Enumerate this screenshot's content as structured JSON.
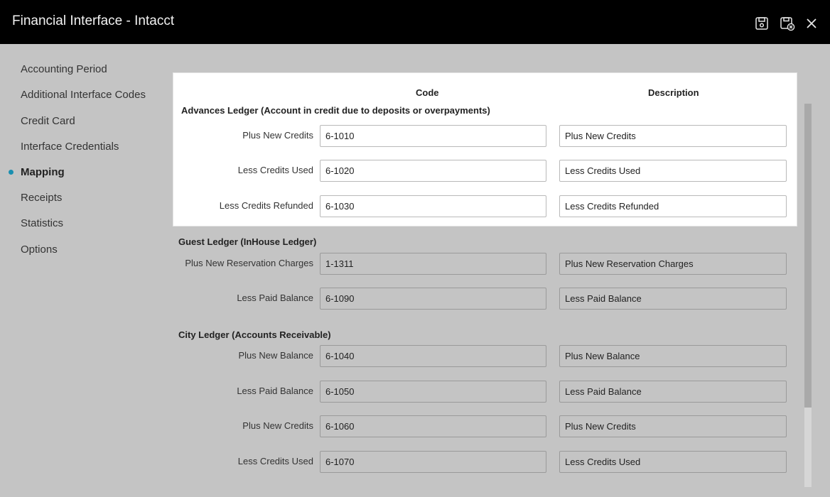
{
  "window": {
    "title": "Financial Interface - Intacct"
  },
  "toolbar": {
    "save_icon": "save-icon",
    "save_close_icon": "save-and-close-icon",
    "close_icon": "close-icon"
  },
  "sidebar": {
    "items": [
      {
        "label": "Accounting Period"
      },
      {
        "label": "Additional Interface Codes"
      },
      {
        "label": "Credit Card"
      },
      {
        "label": "Interface Credentials"
      },
      {
        "label": "Mapping",
        "active": true
      },
      {
        "label": "Receipts"
      },
      {
        "label": "Statistics"
      },
      {
        "label": "Options"
      }
    ],
    "accent_color": "#1a8fb0"
  },
  "columns": {
    "code": "Code",
    "description": "Description"
  },
  "sections": {
    "advances": {
      "title": "Advances Ledger (Account in credit due to deposits or overpayments)",
      "rows": [
        {
          "label": "Plus New Credits",
          "code": "6-1010",
          "description": "Plus New Credits"
        },
        {
          "label": "Less Credits Used",
          "code": "6-1020",
          "description": "Less Credits Used"
        },
        {
          "label": "Less Credits Refunded",
          "code": "6-1030",
          "description": "Less Credits Refunded"
        }
      ]
    },
    "guest": {
      "title": "Guest Ledger (InHouse Ledger)",
      "rows": [
        {
          "label": "Plus New Reservation Charges",
          "code": "1-1311",
          "description": "Plus New Reservation Charges"
        },
        {
          "label": "Less Paid Balance",
          "code": "6-1090",
          "description": "Less Paid Balance"
        }
      ]
    },
    "city": {
      "title": "City Ledger (Accounts Receivable)",
      "rows": [
        {
          "label": "Plus New Balance",
          "code": "6-1040",
          "description": "Plus New Balance"
        },
        {
          "label": "Less Paid Balance",
          "code": "6-1050",
          "description": "Less Paid Balance"
        },
        {
          "label": "Plus New Credits",
          "code": "6-1060",
          "description": "Plus New Credits"
        },
        {
          "label": "Less Credits Used",
          "code": "6-1070",
          "description": "Less Credits Used"
        }
      ]
    }
  }
}
